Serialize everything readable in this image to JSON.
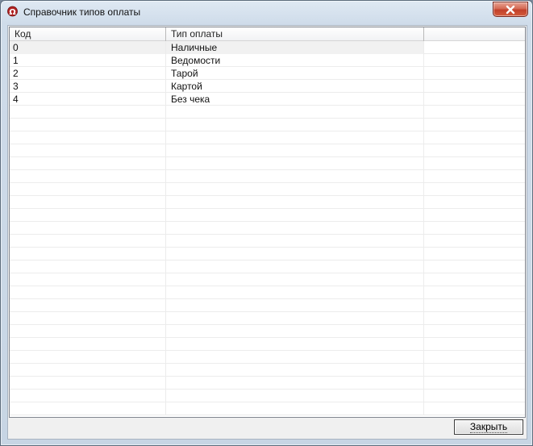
{
  "window": {
    "title": "Справочник типов оплаты",
    "app_icon": "omega-app-icon",
    "close_icon": "close-icon"
  },
  "grid": {
    "columns": [
      "Код",
      "Тип оплаты",
      ""
    ],
    "rows": [
      {
        "code": "0",
        "type": "Наличные"
      },
      {
        "code": "1",
        "type": "Ведомости"
      },
      {
        "code": "2",
        "type": "Тарой"
      },
      {
        "code": "3",
        "type": "Картой"
      },
      {
        "code": "4",
        "type": "Без чека"
      }
    ],
    "selected_row": 0
  },
  "footer": {
    "close_label": "Закрыть"
  },
  "colors": {
    "close_button_red": "#c2402a",
    "title_gradient": "#dfe9f3",
    "selected_row": "#f1f1f1"
  }
}
